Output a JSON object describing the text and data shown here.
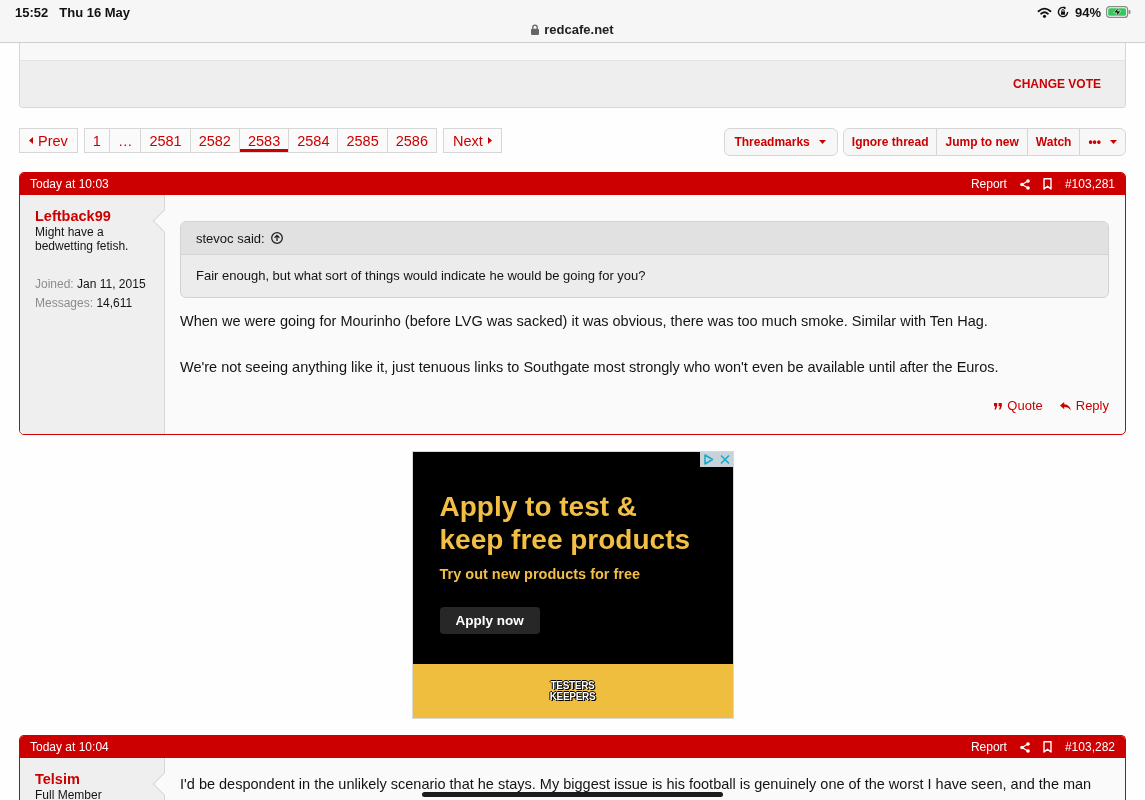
{
  "status_bar": {
    "time": "15:52",
    "date": "Thu 16 May",
    "url": "redcafe.net",
    "battery": "94%"
  },
  "poll": {
    "action": "CHANGE VOTE"
  },
  "pagination": {
    "prev": "Prev",
    "pages": [
      {
        "label": "1",
        "selected": false
      },
      {
        "label": "…",
        "selected": false
      },
      {
        "label": "2581",
        "selected": false
      },
      {
        "label": "2582",
        "selected": false
      },
      {
        "label": "2583",
        "selected": true
      },
      {
        "label": "2584",
        "selected": false
      },
      {
        "label": "2585",
        "selected": false
      },
      {
        "label": "2586",
        "selected": false
      }
    ],
    "next": "Next"
  },
  "thread_tools": {
    "threadmarks": "Threadmarks",
    "buttons": [
      {
        "label": "Ignore thread",
        "kind": "plain"
      },
      {
        "label": "Jump to new",
        "kind": "plain"
      },
      {
        "label": "Watch",
        "kind": "plain"
      },
      {
        "label": "•••",
        "kind": "menu"
      }
    ]
  },
  "stream": [
    {
      "kind": "post",
      "time": "Today at 10:03",
      "report": "Report",
      "number": "#103,281",
      "author": {
        "name": "Leftback99",
        "title": "Might have a bedwetting fetish.",
        "stats": [
          {
            "label": "Joined:",
            "value": "Jan 11, 2015"
          },
          {
            "label": "Messages:",
            "value": "14,611"
          }
        ]
      },
      "quote": {
        "author": "stevoc said:",
        "text": "Fair enough, but what sort of things would indicate he would be going for you?"
      },
      "paragraphs": [
        "When we were going for Mourinho (before LVG was sacked) it was obvious, there was too much smoke. Similar with Ten Hag.",
        "We're not seeing anything like it, just tenuous links to Southgate most strongly who won't even be available until after the Euros."
      ],
      "actions": [
        {
          "label": "Quote",
          "kind": "quote"
        },
        {
          "label": "Reply",
          "kind": "reply"
        }
      ]
    },
    {
      "kind": "ad",
      "headline": "Apply to test & keep free products",
      "subline": "Try out new products for free",
      "button": "Apply now",
      "brand": "TESTERS KEEPERS"
    },
    {
      "kind": "post",
      "time": "Today at 10:04",
      "report": "Report",
      "number": "#103,282",
      "author": {
        "name": "Telsim",
        "title": "Full Member"
      },
      "paragraphs": [
        "I'd be despondent in the unlikely scenario that he stays. My biggest issue is his football is genuinely one of the worst I have seen, and the man"
      ]
    }
  ]
}
